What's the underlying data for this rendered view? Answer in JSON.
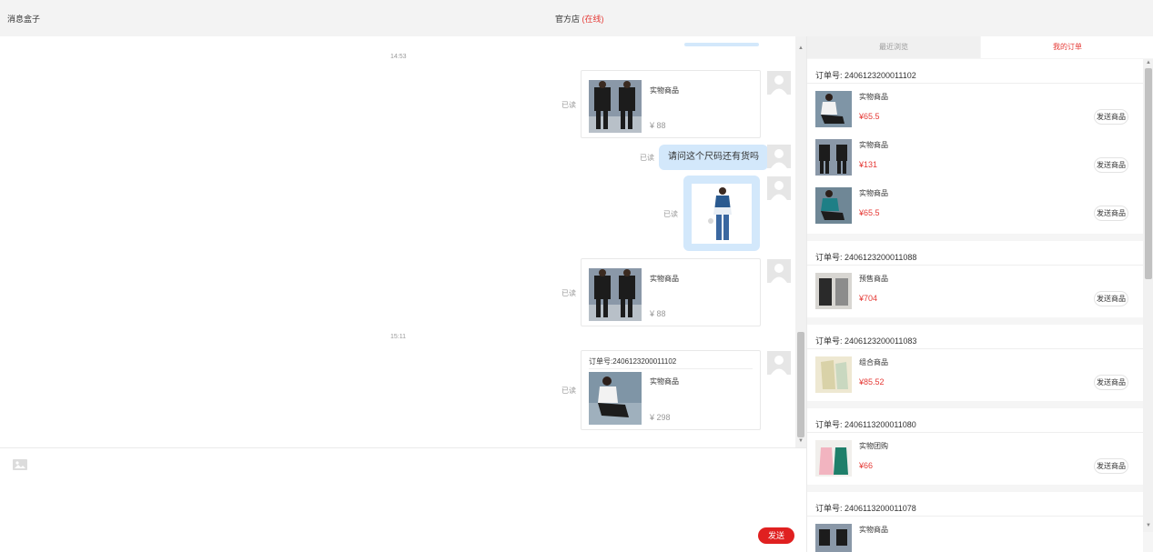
{
  "topbar": {
    "app_title": "消息盒子",
    "shop_name": "官方店",
    "shop_status": "(在线)"
  },
  "chat": {
    "time_1": "14:53",
    "time_2": "15:11",
    "messages": [
      {
        "read": "已读",
        "product_name": "实物商品",
        "price": "¥ 88"
      },
      {
        "read": "已读",
        "text": "请问这个尺码还有货吗"
      },
      {
        "read": "已读",
        "image": "woman-outfit-photo"
      },
      {
        "read": "已读",
        "product_name": "实物商品",
        "price": "¥ 88"
      },
      {
        "read": "已读",
        "order_no": "订单号:2406123200011102",
        "product_name": "实物商品",
        "price": "¥ 298"
      }
    ]
  },
  "composer": {
    "send_label": "发送",
    "image_icon": "image-icon"
  },
  "side": {
    "tabs": [
      {
        "label": "最近浏览"
      },
      {
        "label": "我的订单"
      }
    ],
    "orders": [
      {
        "order_no": "订单号: 2406123200011102",
        "items": [
          {
            "name": "实物商品",
            "price": "¥65.5",
            "action": "发送商品"
          },
          {
            "name": "实物商品",
            "price": "¥131",
            "action": "发送商品"
          },
          {
            "name": "实物商品",
            "price": "¥65.5",
            "action": "发送商品"
          }
        ]
      },
      {
        "order_no": "订单号: 2406123200011088",
        "items": [
          {
            "name": "预售商品",
            "price": "¥704",
            "action": "发送商品"
          }
        ]
      },
      {
        "order_no": "订单号: 2406123200011083",
        "items": [
          {
            "name": "组合商品",
            "price": "¥85.52",
            "action": "发送商品"
          }
        ]
      },
      {
        "order_no": "订单号: 2406113200011080",
        "items": [
          {
            "name": "实物团购",
            "price": "¥66",
            "action": "发送商品"
          }
        ]
      },
      {
        "order_no": "订单号: 2406113200011078",
        "items": [
          {
            "name": "实物商品"
          }
        ]
      }
    ]
  },
  "colors": {
    "accent": "#e53935",
    "bubble": "#d3e8fb",
    "send_button": "#e02020"
  }
}
